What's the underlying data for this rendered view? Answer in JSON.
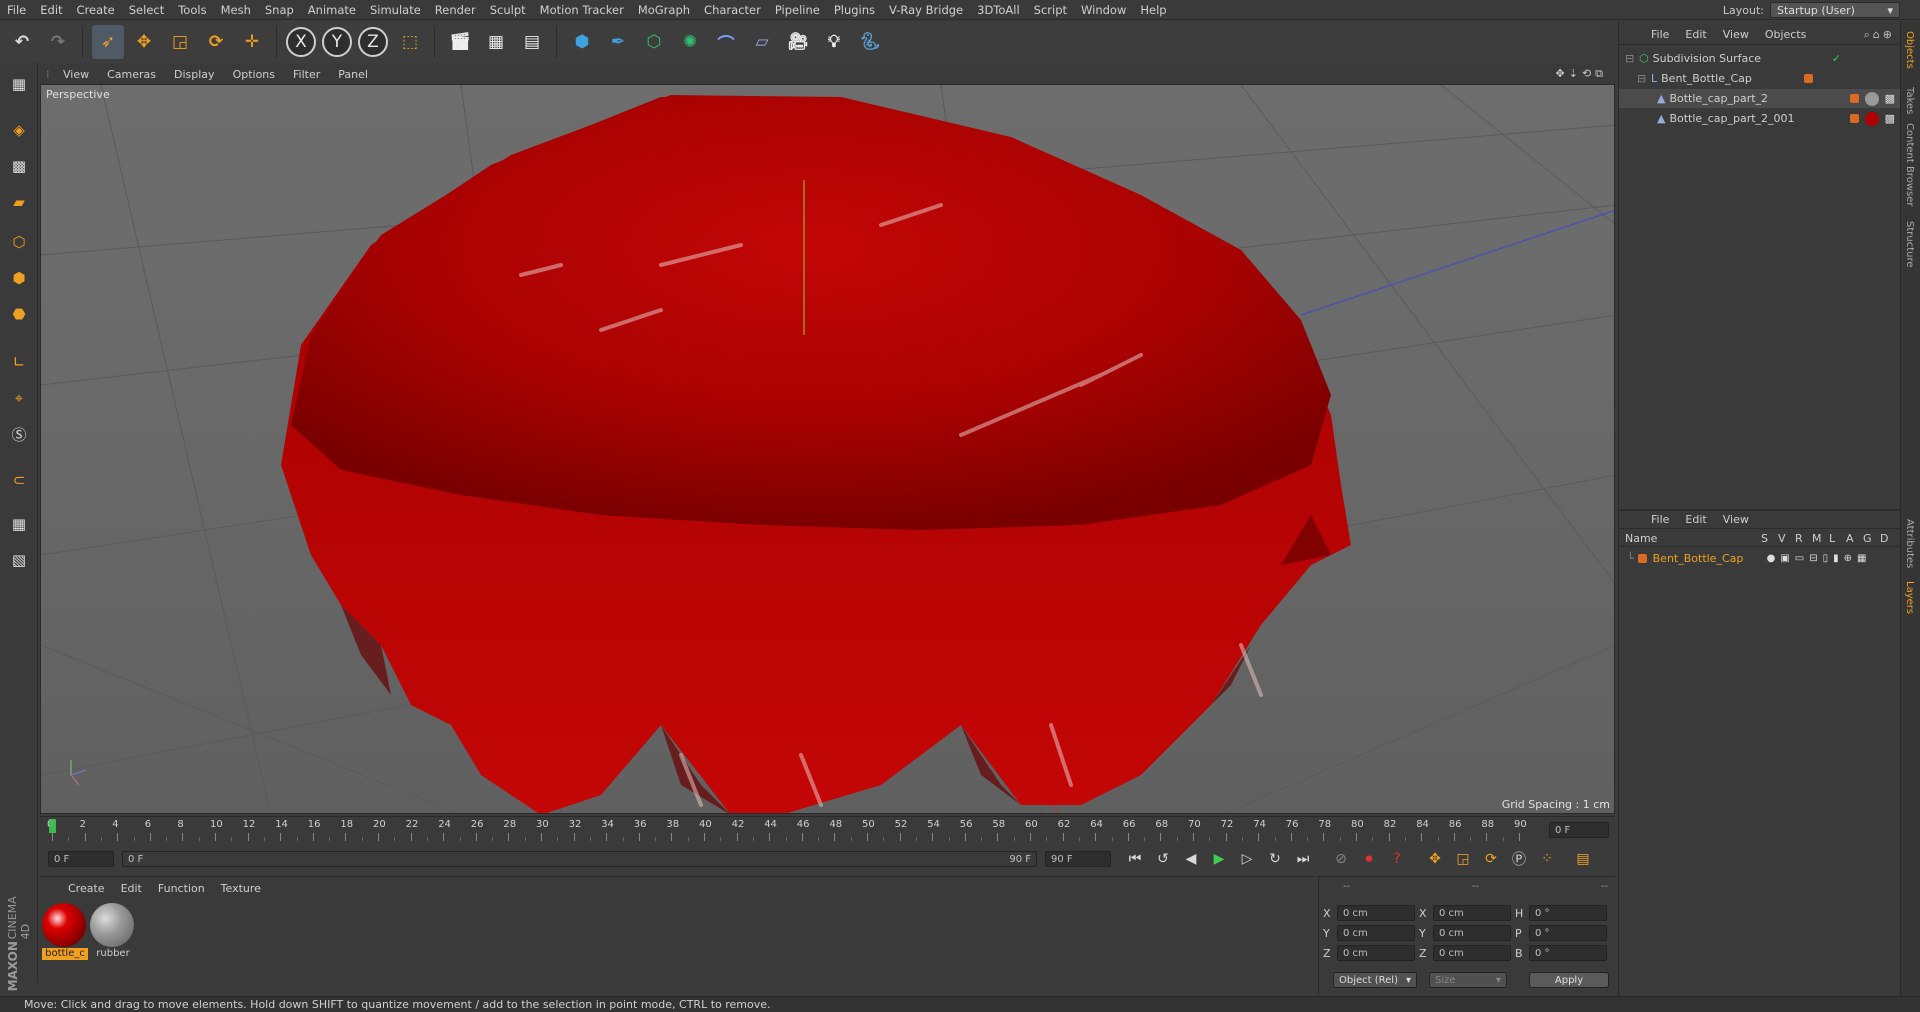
{
  "menubar": {
    "items": [
      "File",
      "Edit",
      "Create",
      "Select",
      "Tools",
      "Mesh",
      "Snap",
      "Animate",
      "Simulate",
      "Render",
      "Sculpt",
      "Motion Tracker",
      "MoGraph",
      "Character",
      "Pipeline",
      "Plugins",
      "V-Ray Bridge",
      "3DToAll",
      "Script",
      "Window",
      "Help"
    ],
    "layout_label": "Layout:",
    "layout_value": "Startup (User)"
  },
  "toolbar": {
    "axis_x": "X",
    "axis_y": "Y",
    "axis_z": "Z"
  },
  "viewport": {
    "menu": [
      "View",
      "Cameras",
      "Display",
      "Options",
      "Filter",
      "Panel"
    ],
    "label": "Perspective",
    "grid_spacing": "Grid Spacing : 1 cm",
    "object_color": "#b00000"
  },
  "timeline": {
    "ticks": [
      "0",
      "2",
      "4",
      "6",
      "8",
      "10",
      "12",
      "14",
      "16",
      "18",
      "20",
      "22",
      "24",
      "26",
      "28",
      "30",
      "32",
      "34",
      "36",
      "38",
      "40",
      "42",
      "44",
      "46",
      "48",
      "50",
      "52",
      "54",
      "56",
      "58",
      "60",
      "62",
      "64",
      "66",
      "68",
      "70",
      "72",
      "74",
      "76",
      "78",
      "80",
      "82",
      "84",
      "86",
      "88",
      "90"
    ],
    "current_frame": "0 F",
    "start_field": "0 F",
    "range_start": "0 F",
    "range_end": "90 F",
    "end_field": "90 F"
  },
  "materials": {
    "menu": [
      "Create",
      "Edit",
      "Function",
      "Texture"
    ],
    "items": [
      {
        "label": "bottle_c",
        "color": "#b00000"
      },
      {
        "label": "rubber",
        "color": "#8a8a8a"
      }
    ]
  },
  "coords": {
    "header": [
      "--",
      "--",
      "--"
    ],
    "rows": [
      {
        "a": "X",
        "v1": "0 cm",
        "b": "X",
        "v2": "0 cm",
        "c": "H",
        "v3": "0 °"
      },
      {
        "a": "Y",
        "v1": "0 cm",
        "b": "Y",
        "v2": "0 cm",
        "c": "P",
        "v3": "0 °"
      },
      {
        "a": "Z",
        "v1": "0 cm",
        "b": "Z",
        "v2": "0 cm",
        "c": "B",
        "v3": "0 °"
      }
    ],
    "mode": "Object (Rel)",
    "size": "Size",
    "apply": "Apply"
  },
  "objects_panel": {
    "menu": [
      "File",
      "Edit",
      "View",
      "Objects"
    ],
    "tree": [
      {
        "name": "Subdivision Surface",
        "level": 0
      },
      {
        "name": "Bent_Bottle_Cap",
        "level": 1
      },
      {
        "name": "Bottle_cap_part_2",
        "level": 2
      },
      {
        "name": "Bottle_cap_part_2_001",
        "level": 2
      }
    ]
  },
  "layers_panel": {
    "menu": [
      "File",
      "Edit",
      "View"
    ],
    "columns": [
      "Name",
      "S",
      "V",
      "R",
      "M",
      "L",
      "A",
      "G",
      "D"
    ],
    "rows": [
      {
        "name": "Bent_Bottle_Cap"
      }
    ]
  },
  "side_tabs": [
    "Objects",
    "Takes",
    "Content Browser",
    "Structure",
    "Attributes",
    "Layers"
  ],
  "branding": {
    "line1": "MAXON",
    "line2": "CINEMA 4D"
  },
  "status": "Move: Click and drag to move elements. Hold down SHIFT to quantize movement / add to the selection in point mode, CTRL to remove."
}
